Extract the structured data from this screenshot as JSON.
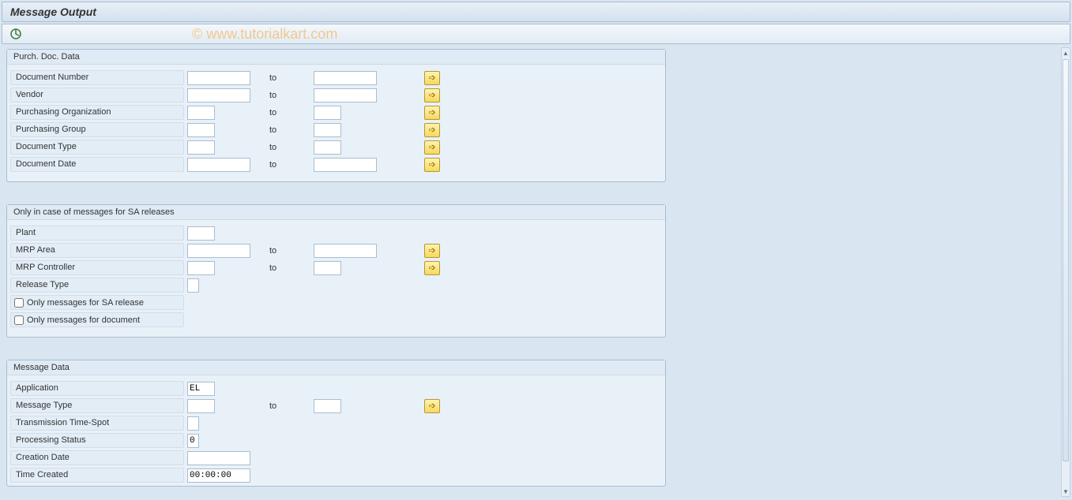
{
  "title": "Message Output",
  "watermark": "© www.tutorialkart.com",
  "to_label": "to",
  "groups": {
    "purch": {
      "title": "Purch. Doc. Data",
      "fields": {
        "doc_number": "Document Number",
        "vendor": "Vendor",
        "purch_org": "Purchasing Organization",
        "purch_grp": "Purchasing Group",
        "doc_type": "Document Type",
        "doc_date": "Document Date"
      }
    },
    "sa": {
      "title": "Only in case of messages for SA releases",
      "fields": {
        "plant": "Plant",
        "mrp_area": "MRP Area",
        "mrp_ctrl": "MRP Controller",
        "release_type": "Release Type"
      },
      "checkboxes": {
        "only_sa": "Only messages for SA release",
        "only_doc": "Only messages for document"
      }
    },
    "msg": {
      "title": "Message Data",
      "fields": {
        "application": "Application",
        "msg_type": "Message Type",
        "trans_time": "Transmission Time-Spot",
        "proc_status": "Processing Status",
        "creation_date": "Creation Date",
        "time_created": "Time Created"
      },
      "values": {
        "application": "EL",
        "proc_status": "0",
        "time_created": "00:00:00"
      }
    }
  }
}
